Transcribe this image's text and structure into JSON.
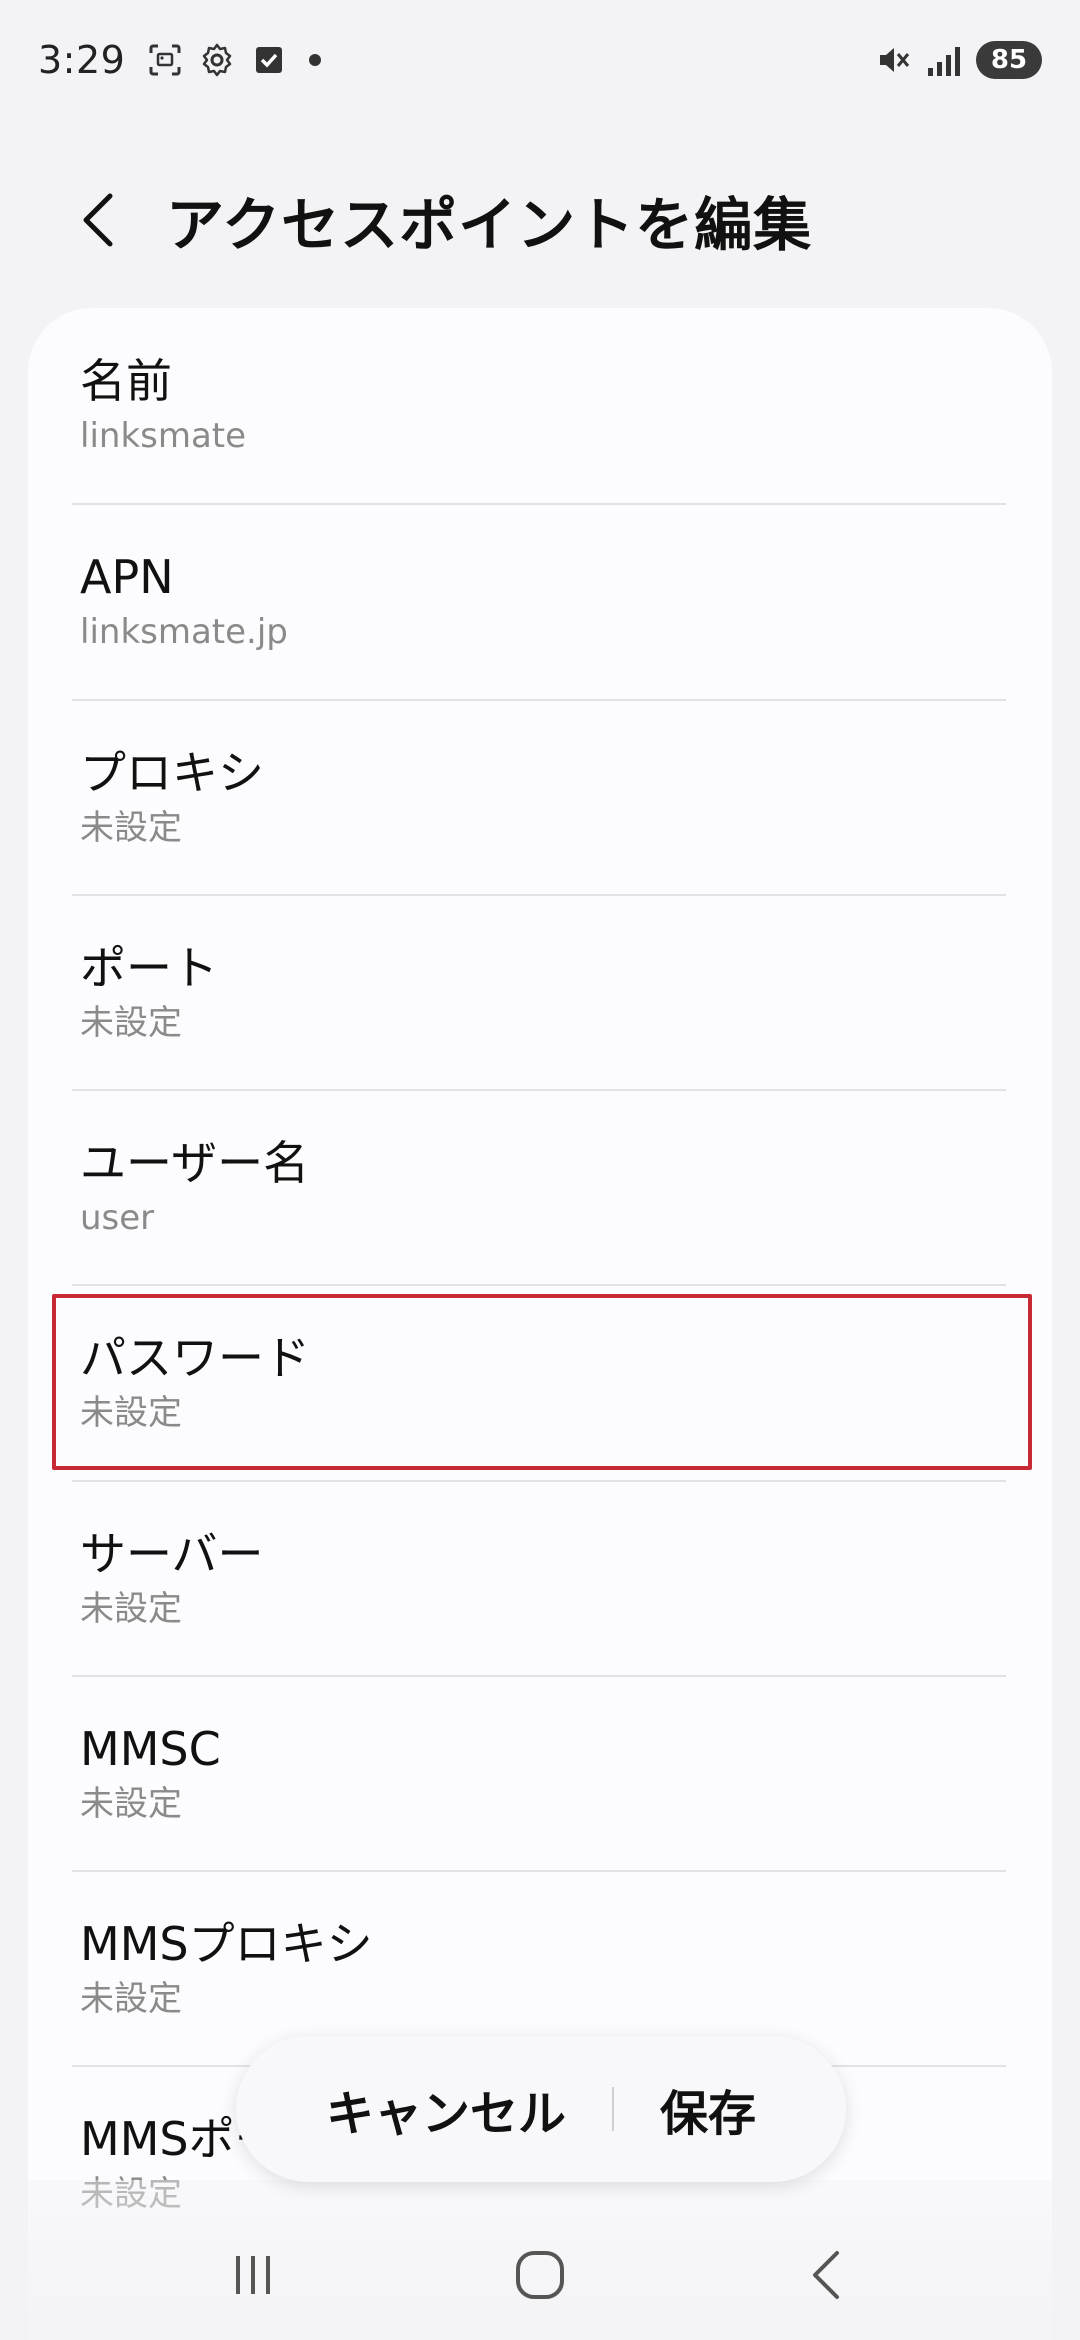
{
  "status_bar": {
    "time": "3:29",
    "left_icons": [
      "screenshot-icon",
      "gear-icon",
      "checkbox-icon",
      "dot-icon"
    ],
    "right_icons": [
      "mute-icon",
      "signal-icon"
    ],
    "battery": "85"
  },
  "header": {
    "back_icon": "chevron-left-icon",
    "title": "アクセスポイントを編集"
  },
  "items": [
    {
      "label": "名前",
      "value": "linksmate"
    },
    {
      "label": "APN",
      "value": "linksmate.jp"
    },
    {
      "label": "プロキシ",
      "value": "未設定"
    },
    {
      "label": "ポート",
      "value": "未設定"
    },
    {
      "label": "ユーザー名",
      "value": "user"
    },
    {
      "label": "パスワード",
      "value": "未設定"
    },
    {
      "label": "サーバー",
      "value": "未設定"
    },
    {
      "label": "MMSC",
      "value": "未設定"
    },
    {
      "label": "MMSプロキシ",
      "value": "未設定"
    },
    {
      "label": "MMSポート",
      "value": "未設定"
    }
  ],
  "actions": {
    "cancel": "キャンセル",
    "save": "保存"
  },
  "highlight_color": "#c82a35",
  "nav": {
    "recents_icon": "recents-icon",
    "home_icon": "home-icon",
    "back_icon": "back-icon"
  }
}
